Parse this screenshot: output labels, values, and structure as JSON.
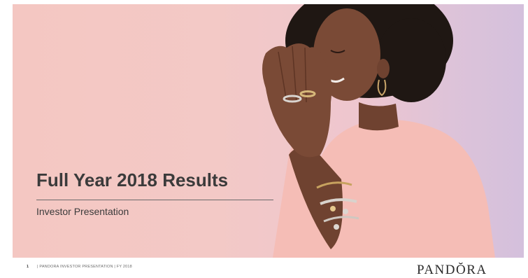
{
  "slide": {
    "title": "Full Year 2018 Results",
    "subtitle": "Investor Presentation"
  },
  "footer": {
    "page_number": "1",
    "text": "| PANDORA INVESTOR PRESENTATION | FY 2018"
  },
  "brand": {
    "logo_text": "PANDŎRA"
  },
  "colors": {
    "background_pink": "#f4c7c2",
    "background_lilac": "#d4c0dc",
    "title_text": "#3b3b3b",
    "sweater": "#f5bdb6",
    "skin": "#7a4a36",
    "hair": "#1f1713"
  }
}
